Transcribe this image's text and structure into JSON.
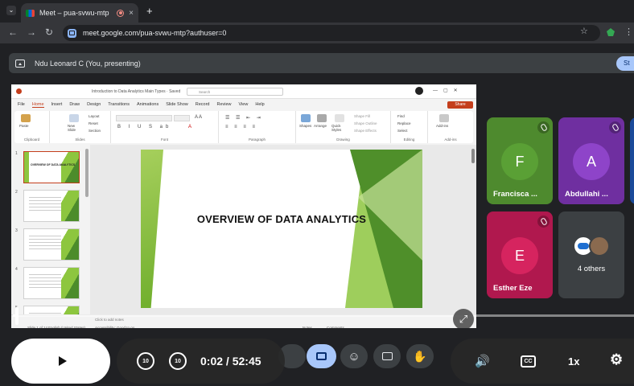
{
  "browser": {
    "tab_title": "Meet – pua-svwu-mtp",
    "tab_close": "×",
    "new_tab": "+",
    "url": "meet.google.com/pua-svwu-mtp?authuser=0"
  },
  "presenting_bar": {
    "label": "Ndu Leonard C (You, presenting)",
    "stop_button": "St"
  },
  "powerpoint": {
    "document_title": "Introduction to Data Analytics Main Types  ·  Saved",
    "search_placeholder": "Search",
    "menus": [
      "File",
      "Home",
      "Insert",
      "Draw",
      "Design",
      "Transitions",
      "Animations",
      "Slide Show",
      "Record",
      "Review",
      "View",
      "Help"
    ],
    "active_menu": "Home",
    "share_label": "Share",
    "ribbon_groups": [
      "Clipboard",
      "Slides",
      "Font",
      "Paragraph",
      "Drawing",
      "Editing",
      "Add-ins"
    ],
    "ribbon_items": {
      "paste": "Paste",
      "new_slide": "New Slide",
      "layout": "Layout",
      "reset": "Reset",
      "section": "Section",
      "shapes": "Shapes",
      "arrange": "Arrange",
      "quick_styles": "Quick Styles",
      "shape_fill": "Shape Fill",
      "shape_outline": "Shape Outline",
      "shape_effects": "Shape Effects",
      "find": "Find",
      "replace": "Replace",
      "select": "Select",
      "add_ins": "Add-ins"
    },
    "thumbnails": [
      {
        "num": "1",
        "text": "OVERVIEW OF DATA ANALYTICS"
      },
      {
        "num": "2",
        "text": ""
      },
      {
        "num": "3",
        "text": ""
      },
      {
        "num": "4",
        "text": ""
      },
      {
        "num": "5",
        "text": ""
      }
    ],
    "slide_title": "OVERVIEW OF DATA ANALYTICS",
    "notes_placeholder": "Click to add notes",
    "status_slide": "Slide 1 of 14",
    "status_language": "English (United States)",
    "status_accessibility": "Accessibility: Good to go",
    "status_notes": "Notes",
    "status_comments": "Comments"
  },
  "participants": [
    {
      "initial": "F",
      "name": "Francisca ...",
      "color": "#4e8a2e",
      "avatar_color": "#5aa035",
      "muted": true
    },
    {
      "initial": "A",
      "name": "Abdullahi ...",
      "color": "#6f2fa0",
      "avatar_color": "#8e44c9",
      "muted": true
    },
    {
      "initial": "E",
      "name": "Esther Eze",
      "color": "#b0184e",
      "avatar_color": "#d6245f",
      "muted": true
    },
    {
      "initial": "",
      "name": "4 others",
      "color": "#3c4043",
      "avatar_color": "#5f6368",
      "muted": false
    }
  ],
  "player": {
    "current_time": "0:02",
    "separator": "/",
    "duration": "52:45",
    "progress_fraction": 0.0006,
    "skip_back": "10",
    "skip_forward": "10",
    "speed": "1x",
    "captions": "CC"
  }
}
